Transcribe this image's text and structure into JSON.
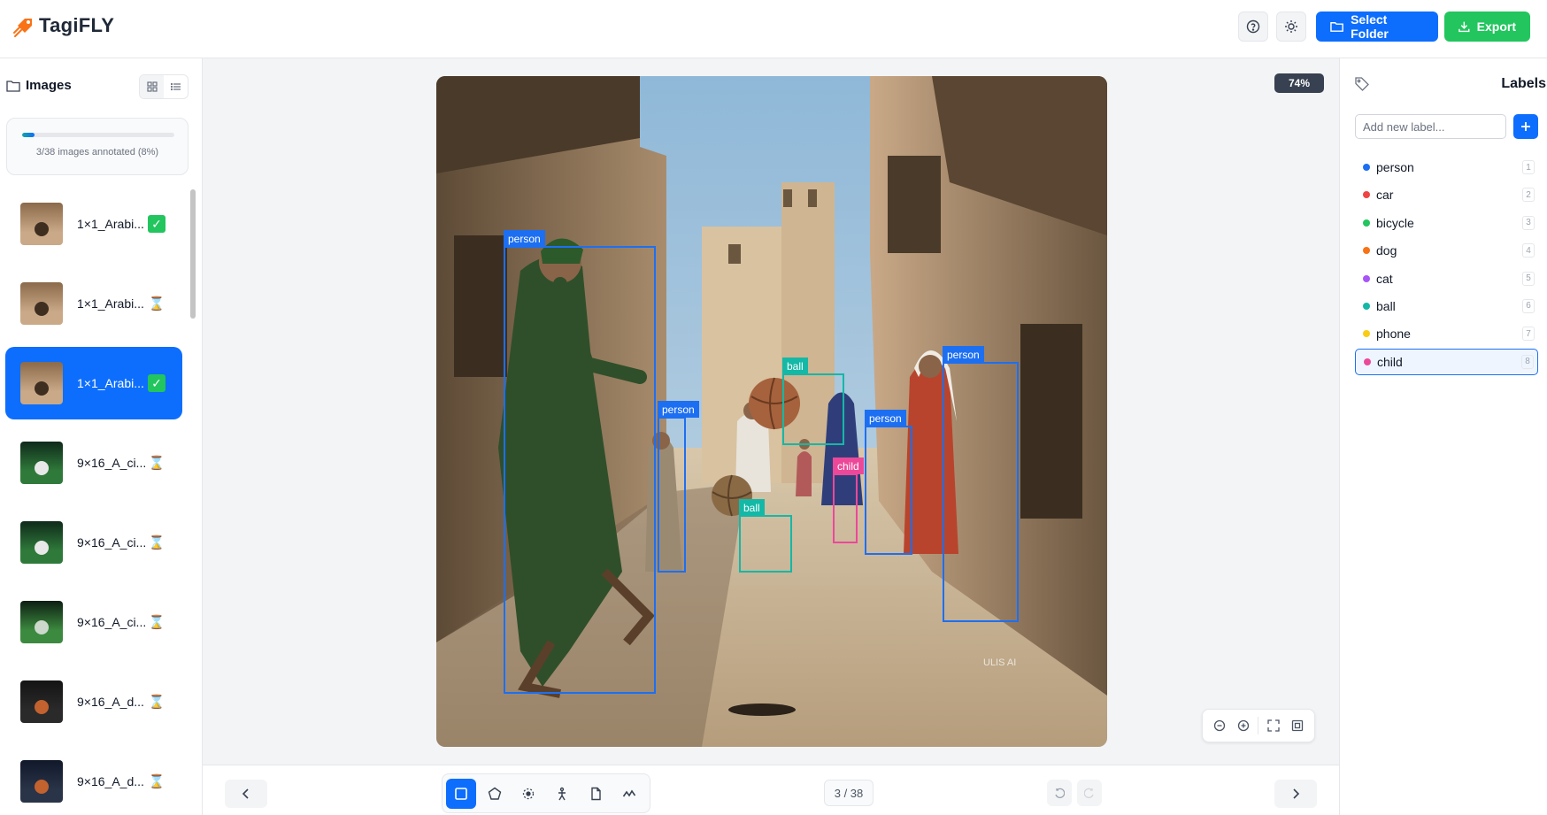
{
  "app": {
    "name": "TagiFLY"
  },
  "header": {
    "select_folder_label": "Select Folder",
    "export_label": "Export"
  },
  "images_panel": {
    "title": "Images",
    "progress": {
      "annotated": 3,
      "total": 38,
      "percent": 8,
      "text": "3/38 images annotated (8%)"
    },
    "items": [
      {
        "name": "1×1_Arabi...",
        "status": "done",
        "thumb": "alley"
      },
      {
        "name": "1×1_Arabi...",
        "status": "pending",
        "thumb": "alley"
      },
      {
        "name": "1×1_Arabi...",
        "status": "done",
        "thumb": "alley",
        "active": true
      },
      {
        "name": "9×16_A_ci...",
        "status": "pending",
        "thumb": "stadium-ball"
      },
      {
        "name": "9×16_A_ci...",
        "status": "pending",
        "thumb": "stadium-ball"
      },
      {
        "name": "9×16_A_ci...",
        "status": "pending",
        "thumb": "stadium-field"
      },
      {
        "name": "9×16_A_d...",
        "status": "pending",
        "thumb": "basketball-dark"
      },
      {
        "name": "9×16_A_d...",
        "status": "pending",
        "thumb": "basketball-hoop"
      }
    ]
  },
  "canvas": {
    "zoom_text": "74%",
    "watermark": "ULIS AI",
    "annotations": [
      {
        "label": "person",
        "color": "#1d6ff2"
      },
      {
        "label": "person",
        "color": "#1d6ff2"
      },
      {
        "label": "ball",
        "color": "#14b8a6"
      },
      {
        "label": "person",
        "color": "#1d6ff2"
      },
      {
        "label": "child",
        "color": "#ec4899"
      },
      {
        "label": "ball",
        "color": "#14b8a6"
      },
      {
        "label": "person",
        "color": "#1d6ff2"
      }
    ]
  },
  "toolbar": {
    "page_indicator": "3 / 38",
    "tools": [
      "rectangle-icon",
      "polygon-icon",
      "point-icon",
      "pose-icon",
      "mask-icon",
      "polyline-icon"
    ]
  },
  "labels_panel": {
    "title": "Labels",
    "input_placeholder": "Add new label...",
    "labels": [
      {
        "name": "person",
        "key": "1",
        "color": "#1d6ff2"
      },
      {
        "name": "car",
        "key": "2",
        "color": "#ef4444"
      },
      {
        "name": "bicycle",
        "key": "3",
        "color": "#22c55e"
      },
      {
        "name": "dog",
        "key": "4",
        "color": "#f97316"
      },
      {
        "name": "cat",
        "key": "5",
        "color": "#a855f7"
      },
      {
        "name": "ball",
        "key": "6",
        "color": "#14b8a6"
      },
      {
        "name": "phone",
        "key": "7",
        "color": "#facc15"
      },
      {
        "name": "child",
        "key": "8",
        "color": "#ec4899",
        "selected": true
      }
    ]
  },
  "colors": {
    "primary": "#0d6efd",
    "success": "#22c55e",
    "border": "#e5e7eb",
    "canvas_bg": "#f3f4f6"
  }
}
